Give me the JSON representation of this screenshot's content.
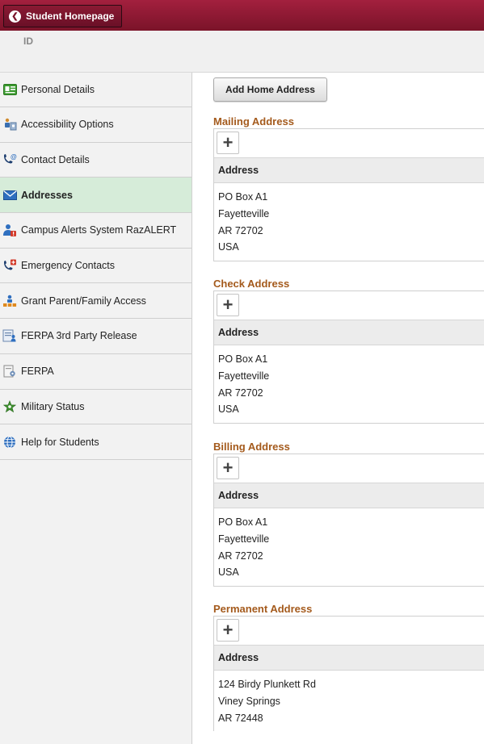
{
  "header": {
    "home_label": "Student Homepage",
    "id_label": "ID"
  },
  "sidebar": {
    "items": [
      {
        "label": "Personal Details",
        "icon": "id-card-icon"
      },
      {
        "label": "Accessibility Options",
        "icon": "accessibility-icon"
      },
      {
        "label": "Contact Details",
        "icon": "phone-at-icon"
      },
      {
        "label": "Addresses",
        "icon": "envelope-icon",
        "active": true
      },
      {
        "label": "Campus Alerts System RazALERT",
        "icon": "person-alert-icon"
      },
      {
        "label": "Emergency Contacts",
        "icon": "phone-cross-icon"
      },
      {
        "label": "Grant Parent/Family Access",
        "icon": "family-icon"
      },
      {
        "label": "FERPA 3rd Party Release",
        "icon": "document-person-icon"
      },
      {
        "label": "FERPA",
        "icon": "document-gear-icon"
      },
      {
        "label": "Military Status",
        "icon": "star-icon"
      },
      {
        "label": "Help for Students",
        "icon": "globe-icon"
      }
    ]
  },
  "main": {
    "add_home_label": "Add Home Address",
    "column_header": "Address",
    "plus": "+",
    "sections": [
      {
        "title": "Mailing Address",
        "lines": [
          "PO Box A1",
          "Fayetteville",
          "AR 72702",
          "USA"
        ]
      },
      {
        "title": "Check Address",
        "lines": [
          "PO Box A1",
          "Fayetteville",
          "AR 72702",
          "USA"
        ]
      },
      {
        "title": "Billing Address",
        "lines": [
          "PO Box A1",
          "Fayetteville",
          "AR 72702",
          "USA"
        ]
      },
      {
        "title": "Permanent Address",
        "lines": [
          "124 Birdy Plunkett Rd",
          "Viney Springs",
          "AR 72448"
        ]
      }
    ]
  },
  "colors": {
    "header": "#7a1329",
    "section_title": "#a45a1c",
    "active_nav": "#d6ecd9"
  }
}
